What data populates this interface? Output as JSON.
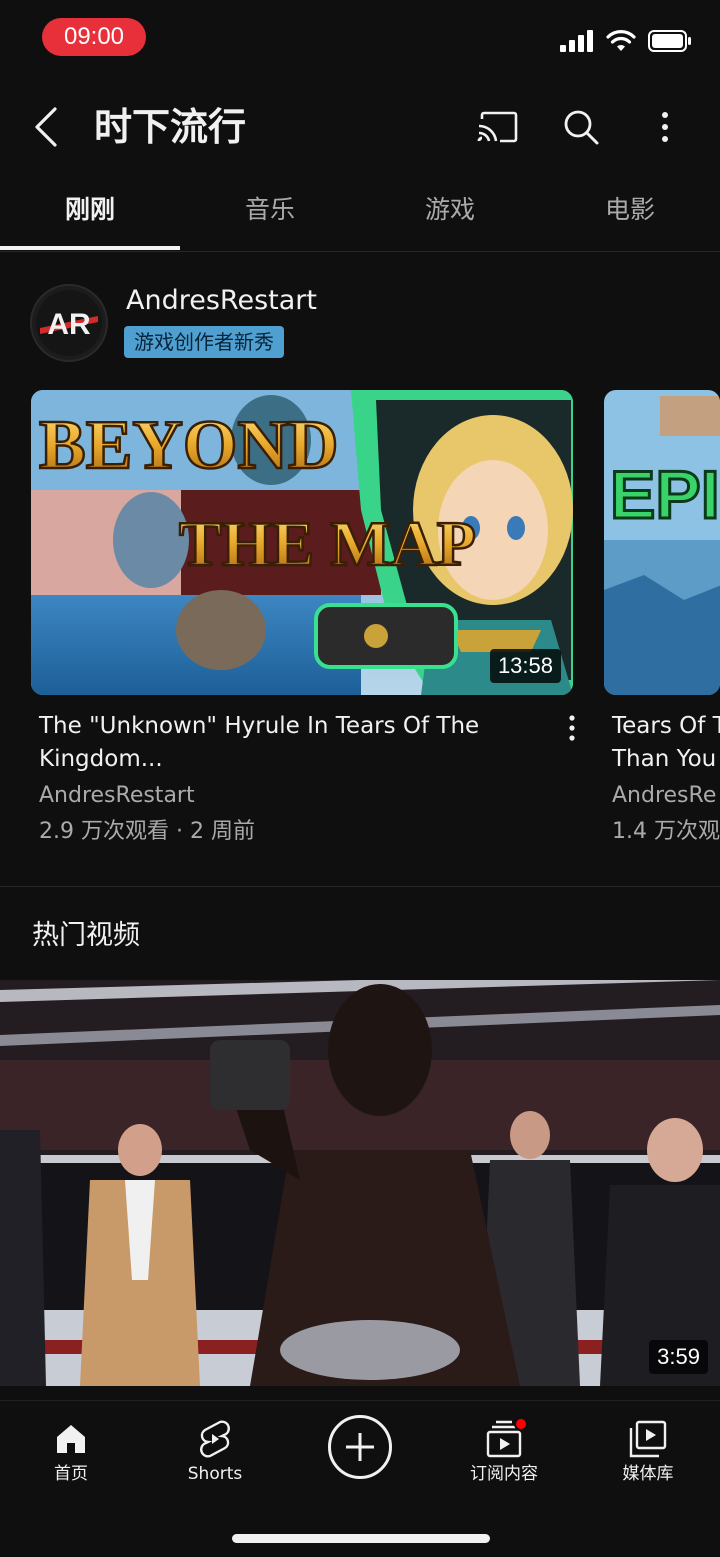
{
  "status_bar": {
    "time": "09:00",
    "signal_icon": "signal-bars-icon",
    "wifi_icon": "wifi-icon",
    "battery_icon": "battery-icon"
  },
  "header": {
    "title": "时下流行",
    "back_icon": "chevron-left-icon",
    "cast_icon": "cast-icon",
    "search_icon": "search-icon",
    "more_icon": "more-vertical-icon"
  },
  "tabs": [
    {
      "label": "刚刚",
      "active": true
    },
    {
      "label": "音乐"
    },
    {
      "label": "游戏"
    },
    {
      "label": "电影"
    }
  ],
  "creator_spotlight": {
    "channel_name": "AndresRestart",
    "avatar_text": "AR",
    "badge": "游戏创作者新秀",
    "videos": [
      {
        "thumbnail_text_top": "BEYOND",
        "thumbnail_text_bottom": "THE MAP",
        "duration": "13:58",
        "title": "The \"Unknown\" Hyrule In Tears Of The Kingdom...",
        "channel": "AndresRestart",
        "meta": "2.9 万次观看 · 2 周前"
      },
      {
        "thumbnail_text": "EPI",
        "title": "Tears Of T Than You",
        "channel": "AndresRe",
        "meta": "1.4 万次观"
      }
    ]
  },
  "trending": {
    "section_title": "热门视频",
    "duration": "3:59"
  },
  "bottom_nav": [
    {
      "label": "首页",
      "icon": "home-icon"
    },
    {
      "label": "Shorts",
      "icon": "shorts-icon"
    },
    {
      "label": "",
      "icon": "plus-circle-icon"
    },
    {
      "label": "订阅内容",
      "icon": "subscriptions-icon"
    },
    {
      "label": "媒体库",
      "icon": "library-icon"
    }
  ],
  "colors": {
    "background": "#0f0f0f",
    "text": "#f1f1f1",
    "secondary_text": "#aaaaaa",
    "time_pill": "#e8303a",
    "badge": "#4fa0d0",
    "notification_dot": "#ff0000"
  }
}
